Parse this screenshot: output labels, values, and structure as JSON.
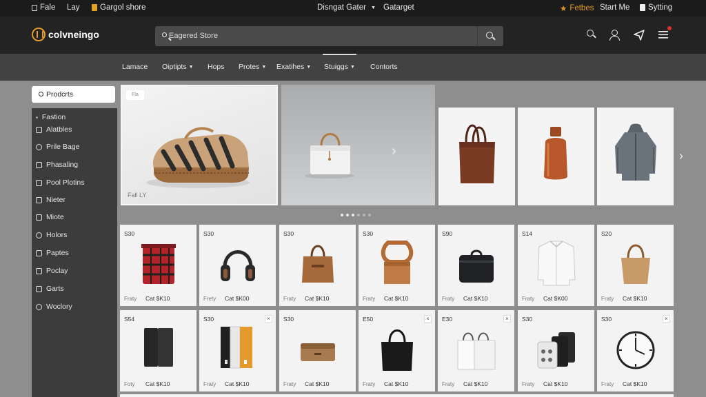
{
  "topbar": {
    "left_items": [
      "Fale",
      "Lay",
      "Gargol shore"
    ],
    "center": "Disngat Gater",
    "center_right": "Gatarget",
    "right_items": [
      "Fetbes",
      "Start Me",
      "Sytting"
    ]
  },
  "header": {
    "logo_text": "colvneingo",
    "search_value": "Eagered Store"
  },
  "nav": {
    "items": [
      {
        "label": "Lamace",
        "caret": false
      },
      {
        "label": "Oiptipts",
        "caret": true
      },
      {
        "label": "Hops",
        "caret": false
      },
      {
        "label": "Protes",
        "caret": true
      },
      {
        "label": "Exatihes",
        "caret": true
      },
      {
        "label": "Stuiggs",
        "caret": true,
        "active": true
      },
      {
        "label": "Contorts",
        "caret": false
      }
    ]
  },
  "sidebar": {
    "header": "Prodcrts",
    "section": "Fastion",
    "items": [
      "Alatbles",
      "Prile Bage",
      "Phasaling",
      "Pool Plotins",
      "Nieter",
      "Miote",
      "Holors",
      "Paptes",
      "Poclay",
      "Garts",
      "Woclory"
    ]
  },
  "hero": {
    "tag": "Fla",
    "caption": "Fall LY"
  },
  "products": {
    "row1": [
      {
        "price": "S30",
        "f1": "Fraty",
        "f2": "Cat $K10",
        "icon": "plaid-bag-icon"
      },
      {
        "price": "S30",
        "f1": "Frety",
        "f2": "Cat $K00",
        "icon": "headphones-icon"
      },
      {
        "price": "S30",
        "f1": "Fraty",
        "f2": "Cat $K10",
        "icon": "brown-handbag-icon"
      },
      {
        "price": "S30",
        "f1": "Fraty",
        "f2": "Cat $K10",
        "icon": "wood-stand-icon"
      },
      {
        "price": "S90",
        "f1": "Fraty",
        "f2": "Cat $K10",
        "icon": "black-case-icon"
      },
      {
        "price": "S14",
        "f1": "Fraty",
        "f2": "Cat $K00",
        "icon": "shirt-icon"
      },
      {
        "price": "S20",
        "f1": "Fraty",
        "f2": "Cat $K10",
        "icon": "tan-tote-icon"
      }
    ],
    "row2": [
      {
        "price": "S54",
        "f1": "Foty",
        "f2": "Cat $K10",
        "icon": "speaker-icon",
        "close": false
      },
      {
        "price": "S30",
        "f1": "Fraty",
        "f2": "Cat $K10",
        "icon": "books-icon",
        "close": true
      },
      {
        "price": "S30",
        "f1": "Fraty",
        "f2": "Cat $K10",
        "icon": "cork-box-icon",
        "close": false
      },
      {
        "price": "E50",
        "f1": "Fraty",
        "f2": "Cat $K10",
        "icon": "black-tote-icon",
        "close": true
      },
      {
        "price": "E30",
        "f1": "Fraty",
        "f2": "Cat $K10",
        "icon": "shopping-bags-icon",
        "close": true
      },
      {
        "price": "S30",
        "f1": "Fraty",
        "f2": "Cat $K10",
        "icon": "device-set-icon",
        "close": false
      },
      {
        "price": "S30",
        "f1": "Fraty",
        "f2": "Cat $K10",
        "icon": "wall-clock-icon",
        "close": true
      }
    ]
  },
  "colors": {
    "accent": "#e39a2a",
    "topbar": "#1b1b1b",
    "header": "#232323",
    "nav": "#424242",
    "sidebar": "#3c3c3c",
    "page": "#8e8e8e"
  }
}
